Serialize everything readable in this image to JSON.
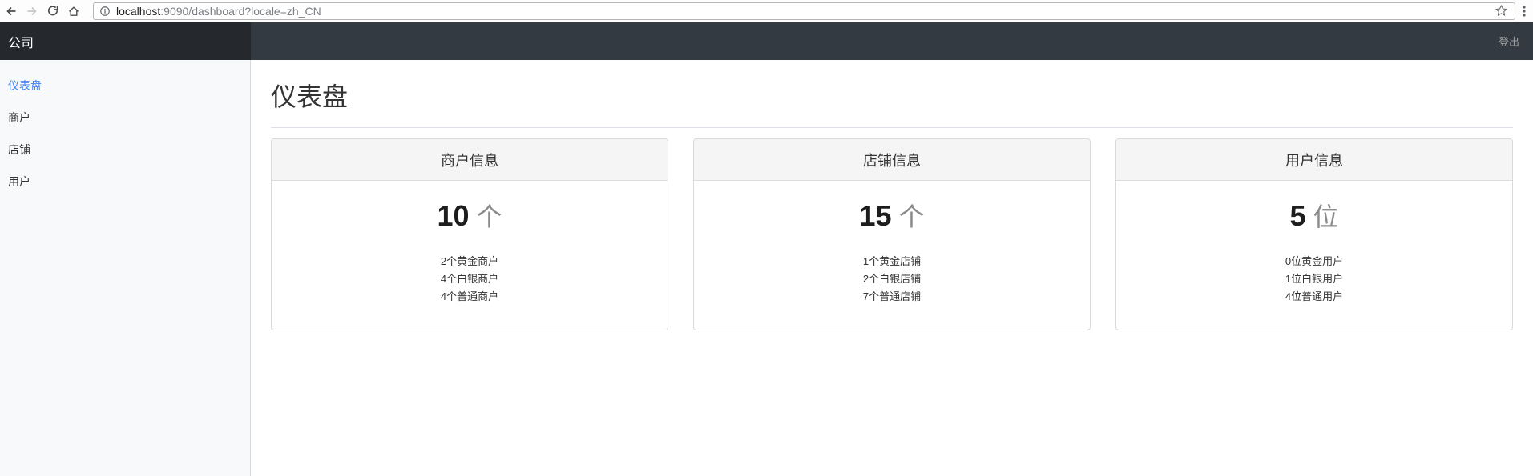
{
  "browser": {
    "url_host": "localhost",
    "url_rest": ":9090/dashboard?locale=zh_CN"
  },
  "navbar": {
    "brand": "公司",
    "logout_label": "登出"
  },
  "sidebar": {
    "items": [
      {
        "label": "仪表盘",
        "active": true
      },
      {
        "label": "商户",
        "active": false
      },
      {
        "label": "店铺",
        "active": false
      },
      {
        "label": "用户",
        "active": false
      }
    ]
  },
  "main": {
    "title": "仪表盘",
    "cards": [
      {
        "title": "商户信息",
        "count": "10",
        "unit": "个",
        "details": [
          "2个黄金商户",
          "4个白银商户",
          "4个普通商户"
        ]
      },
      {
        "title": "店铺信息",
        "count": "15",
        "unit": "个",
        "details": [
          "1个黄金店铺",
          "2个白银店铺",
          "7个普通店铺"
        ]
      },
      {
        "title": "用户信息",
        "count": "5",
        "unit": "位",
        "details": [
          "0位黄金用户",
          "1位白银用户",
          "4位普通用户"
        ]
      }
    ]
  },
  "colors": {
    "navbar_brand_bg": "#25282d",
    "navbar_bg": "#343a41",
    "sidebar_bg": "#f8f9fa",
    "active_link": "#4285f4",
    "card_header_bg": "#f5f5f5",
    "card_border": "#d9d9d9",
    "unit_gray": "#8a8a8a",
    "logout_gray": "#9d9d9d"
  }
}
